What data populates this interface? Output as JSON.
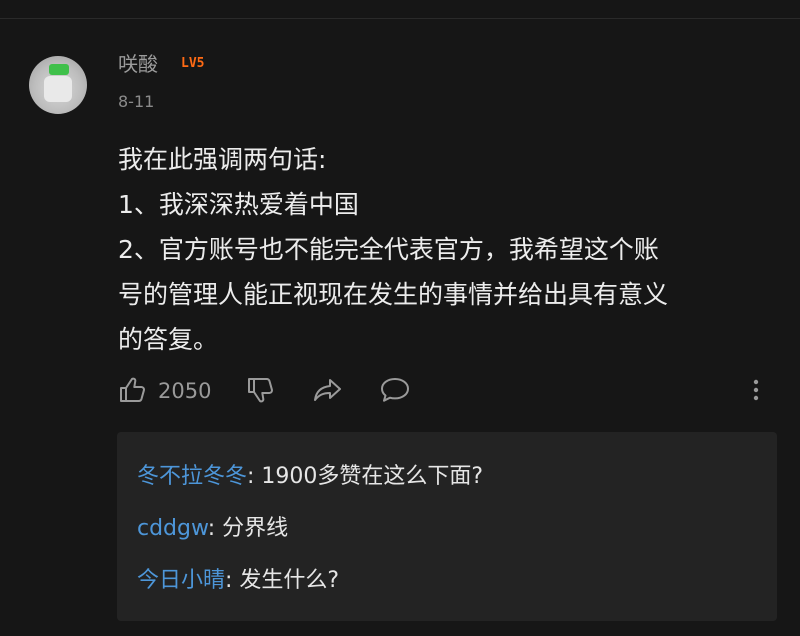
{
  "comment": {
    "username": "咲酸",
    "level": "LV5",
    "date": "8-11",
    "lines": [
      "我在此强调两句话:",
      "1、我深深热爱着中国",
      "2、官方账号也不能完全代表官方，我希望这个账",
      "号的管理人能正视现在发生的事情并给出具有意义",
      "的答复。"
    ],
    "like_count": "2050"
  },
  "replies": [
    {
      "user": "冬不拉冬冬",
      "text": ": 1900多赞在这么下面?"
    },
    {
      "user": "cddgw",
      "text": ": 分界线"
    },
    {
      "user": "今日小晴",
      "text": ": 发生什么?"
    }
  ],
  "colors": {
    "background": "#161616",
    "reply_box": "#232323",
    "reply_user": "#4d96d9",
    "level_badge": "#ff6a14"
  },
  "icons": [
    "thumbs-up-icon",
    "thumbs-down-icon",
    "share-icon",
    "comment-icon",
    "more-vertical-icon"
  ]
}
